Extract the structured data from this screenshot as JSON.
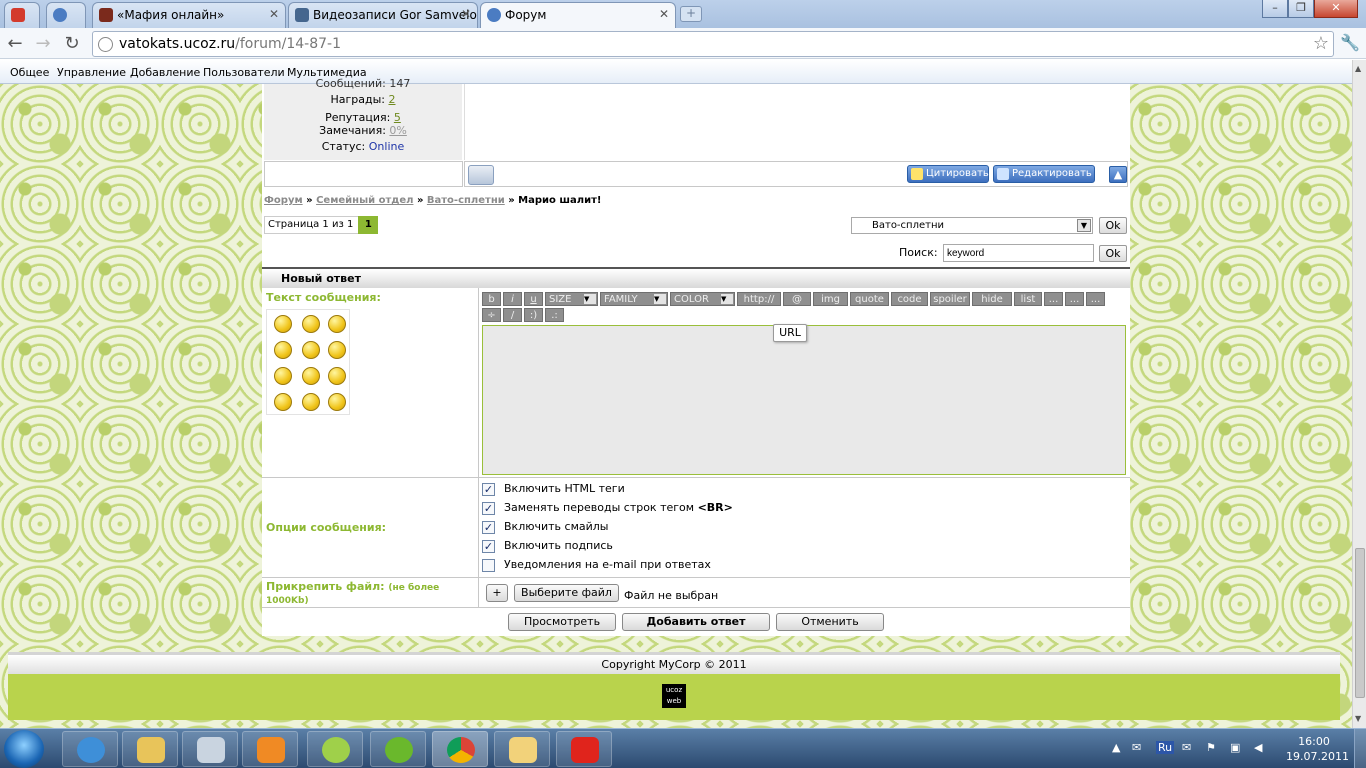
{
  "browser": {
    "tabs": [
      {
        "label": "",
        "favicon_color": "#d33a2c"
      },
      {
        "label": "",
        "favicon_color": "#4b7cc2"
      },
      {
        "label": "«Мафия онлайн»",
        "favicon_color": "#7b2a1c"
      },
      {
        "label": "Видеозаписи Gor Samvelo",
        "favicon_color": "#45668e"
      },
      {
        "label": "Форум",
        "favicon_color": "#4b7cc2"
      }
    ],
    "new_tab_label": "+",
    "window_buttons": [
      "–",
      "❐",
      "✕"
    ],
    "url_host": "vatokats.ucoz.ru",
    "url_path": "/forum/14-87-1"
  },
  "adminbar": {
    "items": [
      "Общее",
      "Управление",
      "Добавление",
      "Пользователи",
      "Мультимедиа"
    ]
  },
  "profile": {
    "messages_label": "Сообщений: 147",
    "awards_label": "Награды:",
    "awards_value": "2",
    "reputation_label": "Репутация:",
    "reputation_value": "5",
    "remarks_label": "Замечания:",
    "remarks_value": "0%",
    "status_label": "Статус:",
    "status_value": "Online"
  },
  "post_buttons": {
    "quote": "Цитировать",
    "edit": "Редактировать",
    "up": "▲"
  },
  "breadcrumb": {
    "items": [
      "Форум",
      "Семейный отдел",
      "Вато-сплетни"
    ],
    "separator": "»",
    "current": "Марио шалит!"
  },
  "pager": {
    "label": "Страница 1 из 1",
    "current": "1"
  },
  "forum_select": {
    "value": "Вато-сплетни",
    "ok": "Ok"
  },
  "search": {
    "label": "Поиск:",
    "value": "keyword",
    "ok": "Ok"
  },
  "reply_form": {
    "title": "Новый ответ",
    "message_label": "Текст сообщения:",
    "bbcodes": [
      "b",
      "i",
      "u",
      "SIZE",
      "FAMILY",
      "COLOR",
      "http://",
      "@",
      "img",
      "quote",
      "code",
      "spoiler",
      "hide",
      "list",
      "...",
      "...",
      "...",
      "÷",
      "/",
      ":)",
      ".:"
    ],
    "url_tooltip": "URL",
    "options_label": "Опции сообщения:",
    "options": [
      {
        "label": "Включить HTML теги",
        "checked": true
      },
      {
        "label": "Заменять переводы строк тегом ",
        "bold": "<BR>",
        "checked": true
      },
      {
        "label": "Включить смайлы",
        "checked": true
      },
      {
        "label": "Включить подпись",
        "checked": true
      },
      {
        "label": "Уведомления на e-mail при ответах",
        "checked": false
      }
    ],
    "attach_label": "Прикрепить файл:",
    "attach_note": "(не более 1000Kb)",
    "add_file": "+",
    "choose_file": "Выберите файл",
    "no_file": "Файл не выбран",
    "preview": "Просмотреть",
    "submit": "Добавить ответ",
    "cancel": "Отменить"
  },
  "footer": {
    "copyright": "Copyright MyCorp © 2011",
    "logo_line1": "ucoz",
    "logo_line2": "web"
  },
  "taskbar": {
    "tray_lang": "Ru",
    "time": "16:00",
    "date": "19.07.2011"
  },
  "colors": {
    "accent_green": "#8db832",
    "footer_green": "#b9d34c",
    "link_blue": "#1f35a8"
  }
}
